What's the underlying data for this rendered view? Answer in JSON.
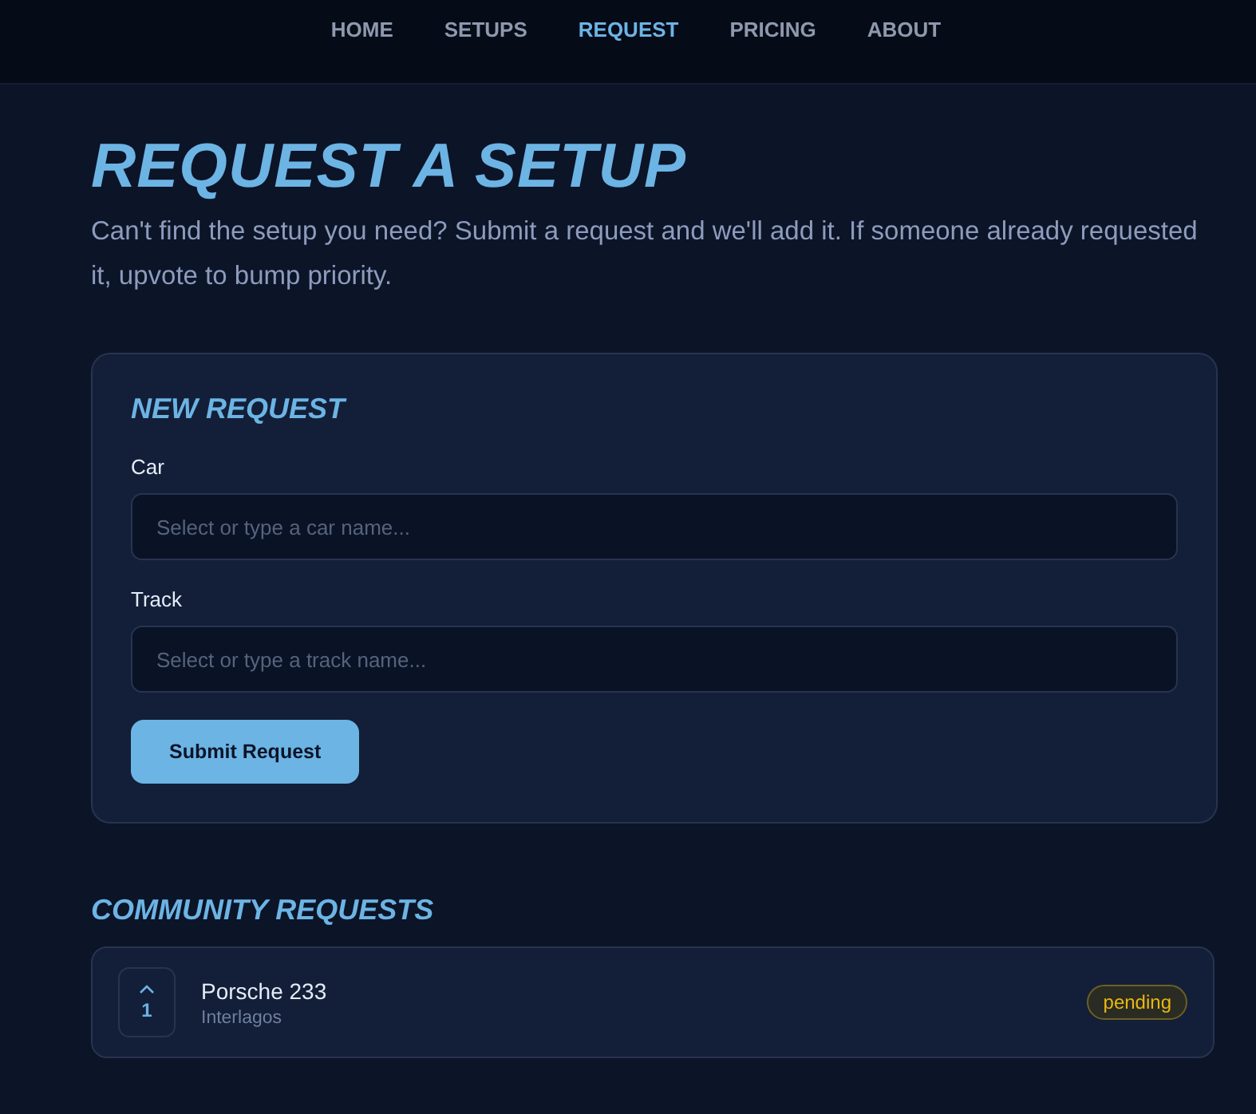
{
  "nav": [
    {
      "label": "HOME",
      "selected": false
    },
    {
      "label": "SETUPS",
      "selected": false
    },
    {
      "label": "REQUEST",
      "selected": true
    },
    {
      "label": "PRICING",
      "selected": false
    },
    {
      "label": "ABOUT",
      "selected": false
    }
  ],
  "page": {
    "title": "REQUEST A SETUP",
    "intro": "Can't find the setup you need? Submit a request and we'll add it. If someone already requested it, upvote to bump priority."
  },
  "form": {
    "title": "NEW REQUEST",
    "fields": [
      {
        "label": "Car",
        "placeholder": "Select or type a car name..."
      },
      {
        "label": "Track",
        "placeholder": "Select or type a track name..."
      }
    ],
    "submit": "Submit Request"
  },
  "community": {
    "title": "COMMUNITY REQUESTS",
    "requests": [
      {
        "votes": "1",
        "car": "Porsche 233",
        "track": "Interlagos",
        "status": "pending"
      }
    ]
  }
}
